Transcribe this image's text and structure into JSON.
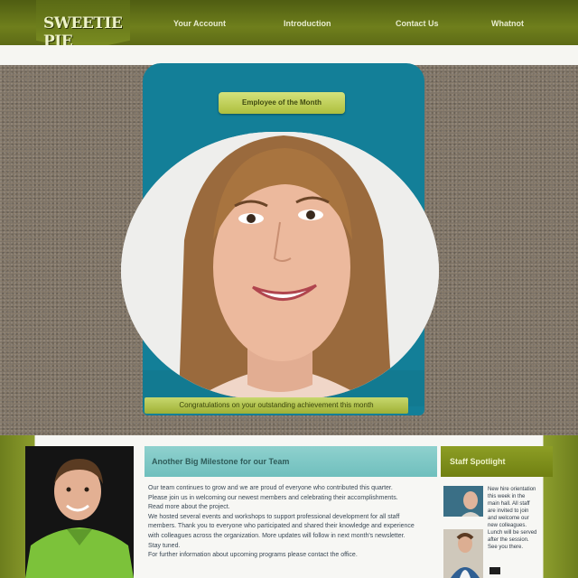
{
  "header": {
    "logo": "SWEETIE PIE",
    "nav": [
      "Your Account",
      "Introduction",
      "Contact Us",
      "Whatnot"
    ]
  },
  "hero": {
    "card_title": "Employee of the Month",
    "caption": "Congratulations on your outstanding achievement this month"
  },
  "content": {
    "section_title": "Another Big Milestone for our Team",
    "side_title": "Staff Spotlight",
    "body_lines": [
      "Our team continues to grow and we are proud of everyone who contributed this quarter.",
      "Please join us in welcoming our newest members and celebrating their accomplishments.",
      "Read more about the project.",
      "We hosted several events and workshops to support professional development for all staff",
      "members. Thank you to everyone who participated and shared their knowledge and experience",
      "with colleagues across the organization. More updates will follow in next month's newsletter.",
      "Stay tuned.",
      "For further information about upcoming programs please contact the office."
    ],
    "side_lines": [
      "New hire orientation",
      "this week in the",
      "main hall. All staff",
      "are invited to join",
      "and welcome our",
      "new colleagues.",
      "Lunch will be served",
      "after the session.",
      "See you there."
    ]
  },
  "colors": {
    "header_green": "#6f7f1c",
    "card_teal": "#137f98",
    "accent_lime": "#b6c74a",
    "section_teal": "#7fc8c6"
  }
}
